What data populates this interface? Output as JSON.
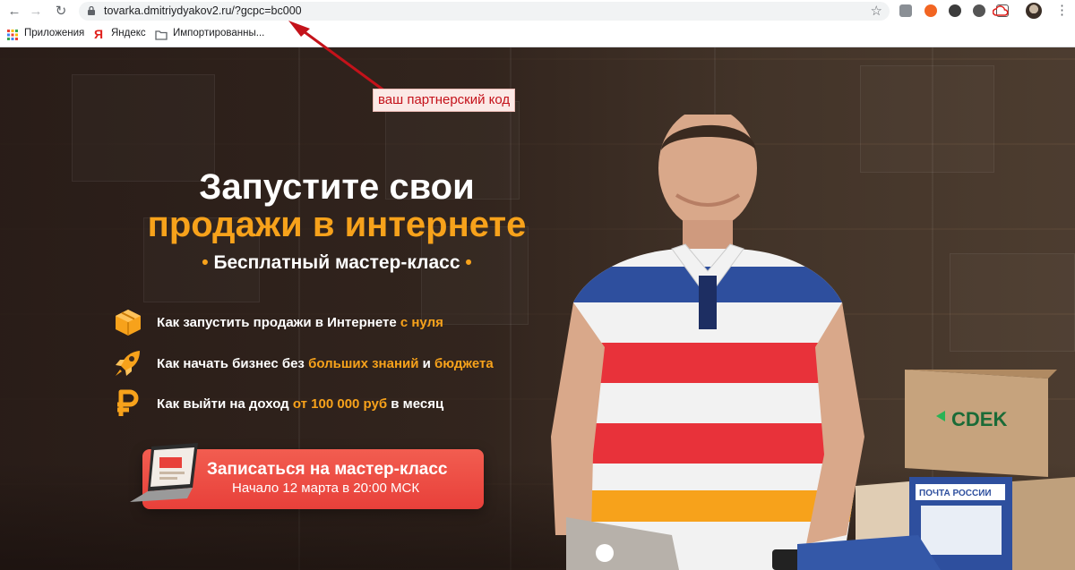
{
  "browser": {
    "url": "tovarka.dmitriydyakov2.ru/?gcpc=bc000",
    "bookmarks": [
      {
        "label": "Приложения",
        "icon": "apps-grid-icon"
      },
      {
        "label": "Яндекс",
        "icon": "yandex-icon"
      },
      {
        "label": "Импортированны...",
        "icon": "folder-icon"
      }
    ]
  },
  "annotation": {
    "label": "ваш партнерский код",
    "color": "#c4121a"
  },
  "hero": {
    "title_line1": "Запустите свои",
    "title_line2": "продажи в интернете",
    "subtitle": "Бесплатный мастер-класс",
    "features": [
      {
        "icon": "box-icon",
        "text_before": "Как запустить продажи в Интернете ",
        "highlight1": "с нуля",
        "text_mid": "",
        "highlight2": "",
        "text_after": ""
      },
      {
        "icon": "rocket-icon",
        "text_before": "Как начать бизнес без ",
        "highlight1": "больших знаний",
        "text_mid": " и ",
        "highlight2": "бюджета",
        "text_after": ""
      },
      {
        "icon": "ruble-icon",
        "text_before": "Как выйти на доход ",
        "highlight1": "от 100 000 руб",
        "text_mid": " в месяц",
        "highlight2": "",
        "text_after": ""
      }
    ],
    "cta": {
      "title": "Записаться на мастер-класс",
      "subtitle": "Начало 12 марта в 20:00 МСК"
    },
    "box_labels": {
      "cdek": "CDEK",
      "post": "ПОЧТА РОССИИ"
    }
  },
  "colors": {
    "accent": "#f7a21b",
    "cta": "#e8403a",
    "annotation": "#c4121a"
  }
}
